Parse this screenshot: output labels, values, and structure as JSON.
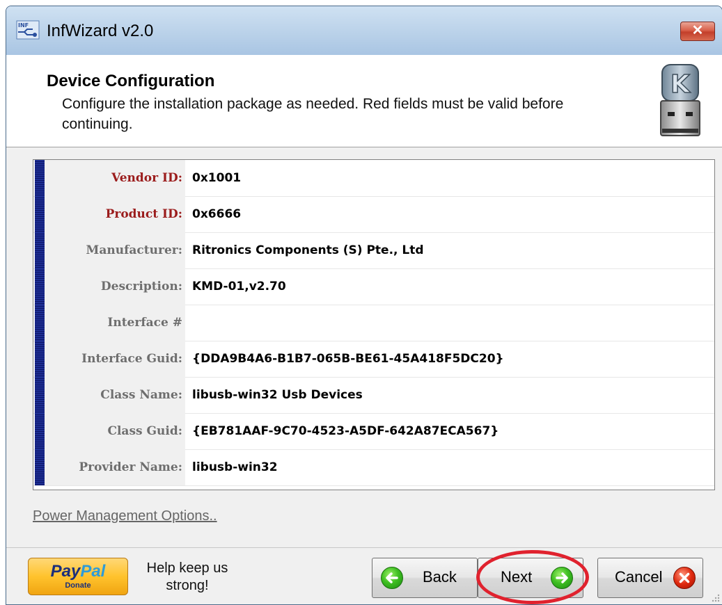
{
  "window": {
    "title": "InfWizard v2.0",
    "close_label": "✕"
  },
  "header": {
    "title": "Device Configuration",
    "description": "Configure the installation package as needed. Red fields must be valid before continuing."
  },
  "fields": [
    {
      "label": "Vendor ID:",
      "value": "0x1001",
      "required": true
    },
    {
      "label": "Product ID:",
      "value": "0x6666",
      "required": true
    },
    {
      "label": "Manufacturer:",
      "value": "Ritronics Components (S) Pte., Ltd",
      "required": false
    },
    {
      "label": "Description:",
      "value": "KMD-01,v2.70",
      "required": false
    },
    {
      "label": "Interface #",
      "value": "",
      "required": false
    },
    {
      "label": "Interface Guid:",
      "value": "{DDA9B4A6-B1B7-065B-BE61-45A418F5DC20}",
      "required": false
    },
    {
      "label": "Class Name:",
      "value": "libusb-win32 Usb Devices",
      "required": false
    },
    {
      "label": "Class Guid:",
      "value": "{EB781AAF-9C70-4523-A5DF-642A87ECA567}",
      "required": false
    },
    {
      "label": "Provider Name:",
      "value": "libusb-win32",
      "required": false
    }
  ],
  "power_link": "Power Management Options..",
  "paypal": {
    "brand_part1": "Pay",
    "brand_part2": "Pal",
    "sub": "Donate"
  },
  "help_text": "Help keep us strong!",
  "buttons": {
    "back": "Back",
    "next": "Next",
    "cancel": "Cancel"
  },
  "colors": {
    "required_label": "#9b1c1c",
    "optional_label": "#6e6e6e",
    "highlight_ellipse": "#e0222e",
    "title_bar": "#bcd3ea",
    "close_button": "#c33f2a"
  },
  "icons": {
    "app": "infwizard-app-icon",
    "header": "usb-k-drive-icon",
    "back": "green-arrow-left-icon",
    "next": "green-arrow-right-icon",
    "cancel": "red-x-icon"
  }
}
